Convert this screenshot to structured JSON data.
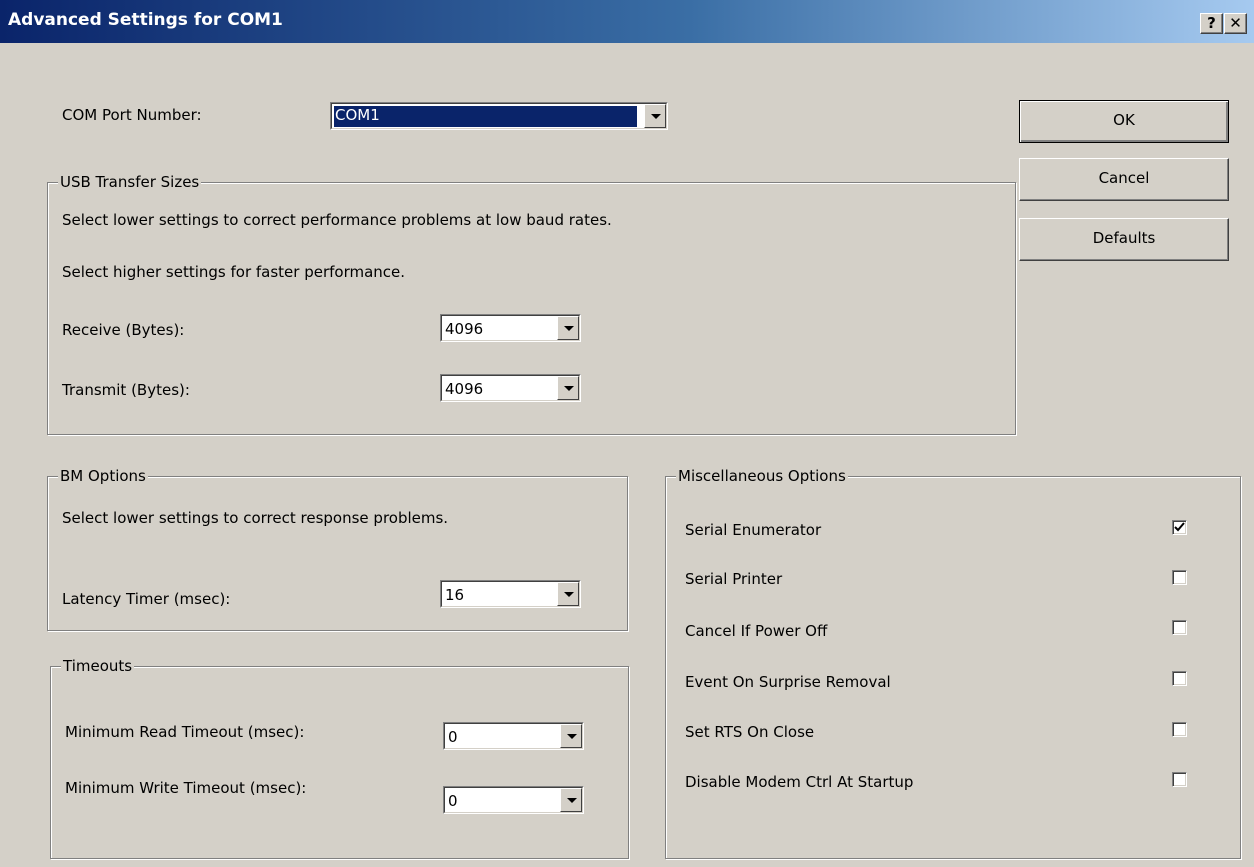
{
  "window": {
    "title": "Advanced Settings for COM1",
    "help_glyph": "?",
    "close_glyph": "✕"
  },
  "com_port": {
    "label": "COM Port Number:",
    "value": "COM1"
  },
  "buttons": {
    "ok": "OK",
    "cancel": "Cancel",
    "defaults": "Defaults"
  },
  "usb_transfer": {
    "title": "USB Transfer Sizes",
    "note_lower": "Select lower settings to correct performance problems at low baud rates.",
    "note_higher": "Select higher settings for faster performance.",
    "receive_label": "Receive (Bytes):",
    "receive_value": "4096",
    "transmit_label": "Transmit (Bytes):",
    "transmit_value": "4096"
  },
  "bm_options": {
    "title": "BM Options",
    "note": "Select lower settings to correct response problems.",
    "latency_label": "Latency Timer (msec):",
    "latency_value": "16"
  },
  "timeouts": {
    "title": "Timeouts",
    "read_label": "Minimum Read Timeout (msec):",
    "read_value": "0",
    "write_label": "Minimum Write Timeout (msec):",
    "write_value": "0"
  },
  "misc_options": {
    "title": "Miscellaneous Options",
    "items": [
      {
        "label": "Serial Enumerator",
        "checked": true
      },
      {
        "label": "Serial Printer",
        "checked": false
      },
      {
        "label": "Cancel If Power Off",
        "checked": false
      },
      {
        "label": "Event On Surprise Removal",
        "checked": false
      },
      {
        "label": "Set RTS On Close",
        "checked": false
      },
      {
        "label": "Disable Modem Ctrl At Startup",
        "checked": false
      }
    ]
  },
  "icons": {
    "dropdown": "chevron-down-icon",
    "check": "checkmark-icon"
  }
}
